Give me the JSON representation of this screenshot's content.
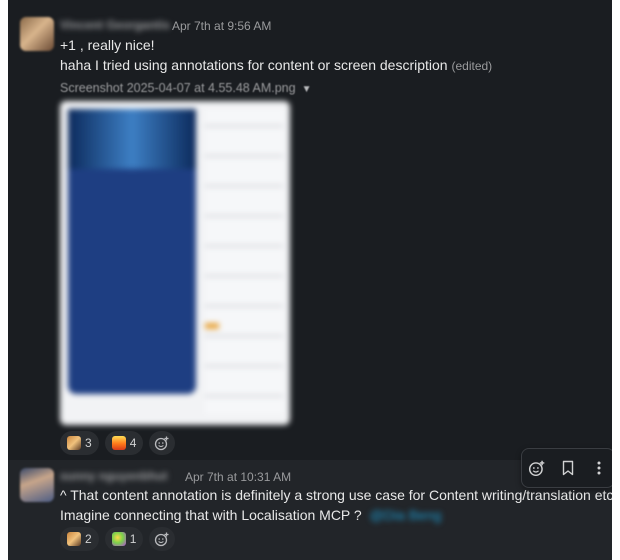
{
  "message1": {
    "author": "Vincent Georgantis",
    "timestamp": "Apr 7th at 9:56 AM",
    "line1": "+1 , really nice!",
    "line2": "haha I tried using annotations for content or screen description",
    "edited": "(edited)",
    "attachment_name": "Screenshot 2025-04-07 at 4.55.48 AM.png",
    "reactions": [
      {
        "emoji": "person-emoji",
        "count": "3"
      },
      {
        "emoji": "fire-emoji",
        "count": "4"
      }
    ]
  },
  "message2": {
    "author": "sunny nguyenbhut",
    "timestamp": "Apr 7th at 10:31 AM",
    "line1": "^ That content annotation is definitely a strong use case for Content writing/translation etc.",
    "line2": "Imagine connecting that with Localisation MCP ?",
    "link_text": "@Dia Beng",
    "reactions": [
      {
        "emoji": "person-emoji",
        "count": "2"
      },
      {
        "emoji": "dance-emoji",
        "count": "1"
      }
    ]
  },
  "colors": {
    "background": "#1a1d21",
    "hover": "#222529",
    "pill": "#2a2d31",
    "link": "#1d9bd1"
  }
}
